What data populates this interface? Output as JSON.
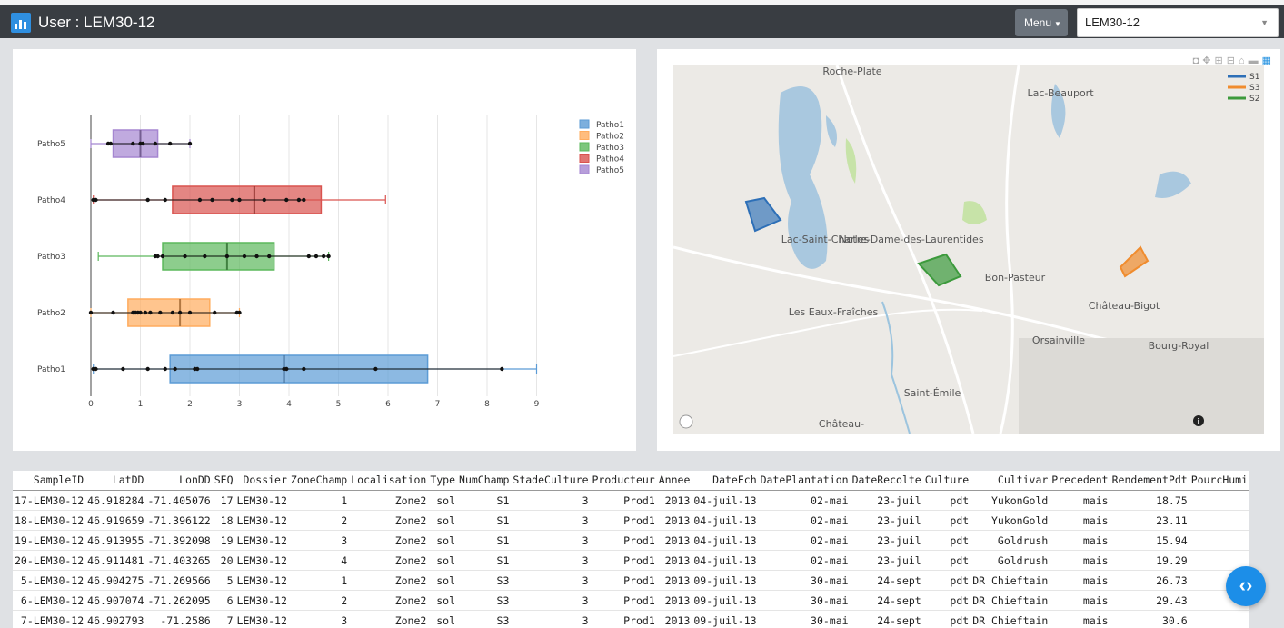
{
  "header": {
    "title": "User : LEM30-12",
    "menu_label": "Menu",
    "user_select_value": "LEM30-12"
  },
  "chart_data": {
    "type": "box",
    "orientation": "horizontal",
    "x_range": [
      0,
      9.5
    ],
    "x_ticks": [
      0,
      1,
      2,
      3,
      4,
      5,
      6,
      7,
      8,
      9
    ],
    "grid": true,
    "legend_position": "top-right",
    "series": [
      {
        "name": "Patho1",
        "color": "#5b9bd5",
        "min": 0.05,
        "q1": 1.6,
        "median": 3.9,
        "q3": 6.8,
        "max": 9.0,
        "points": [
          0.05,
          0.1,
          0.65,
          1.15,
          1.5,
          1.7,
          2.1,
          2.15,
          3.9,
          3.95,
          4.3,
          5.75,
          8.3
        ]
      },
      {
        "name": "Patho2",
        "color": "#ffac5e",
        "min": 0.0,
        "q1": 0.75,
        "median": 1.8,
        "q3": 2.4,
        "max": 3.0,
        "points": [
          0.0,
          0.45,
          0.85,
          0.9,
          0.95,
          1.0,
          1.1,
          1.2,
          1.4,
          1.65,
          1.8,
          2.0,
          2.5,
          2.95,
          3.0
        ]
      },
      {
        "name": "Patho3",
        "color": "#5cb85c",
        "min": 0.15,
        "q1": 1.45,
        "median": 2.75,
        "q3": 3.7,
        "max": 4.8,
        "points": [
          1.3,
          1.35,
          1.45,
          1.9,
          2.3,
          2.75,
          3.1,
          3.35,
          3.6,
          4.4,
          4.55,
          4.7,
          4.8
        ]
      },
      {
        "name": "Patho4",
        "color": "#d9534f",
        "min": 0.05,
        "q1": 1.65,
        "median": 3.3,
        "q3": 4.65,
        "max": 5.95,
        "points": [
          0.05,
          0.1,
          1.15,
          1.5,
          2.2,
          2.45,
          2.85,
          3.0,
          3.5,
          3.95,
          4.2,
          4.3
        ]
      },
      {
        "name": "Patho5",
        "color": "#a586d1",
        "min": 0.0,
        "q1": 0.45,
        "median": 1.0,
        "q3": 1.35,
        "max": 2.0,
        "points": [
          0.35,
          0.4,
          0.85,
          1.0,
          1.05,
          1.3,
          1.6,
          2.0
        ]
      }
    ]
  },
  "map": {
    "places": [
      "Roche-Plate",
      "Lac-Beauport",
      "Lac-Saint-Charles",
      "Notre-Dame-des-Laurentides",
      "Bon-Pasteur",
      "Château-Bigot",
      "Les Eaux-Fraîches",
      "Orsainville",
      "Bourg-Royal",
      "Saint-Émile",
      "Château-"
    ],
    "legend": [
      {
        "name": "S1",
        "color": "#2d6fb7"
      },
      {
        "name": "S3",
        "color": "#f08c2e"
      },
      {
        "name": "S2",
        "color": "#3c9a3c"
      }
    ],
    "polygons": [
      {
        "name": "S1",
        "color": "#2d6fb7"
      },
      {
        "name": "S2",
        "color": "#3c9a3c"
      },
      {
        "name": "S3",
        "color": "#f08c2e"
      }
    ],
    "toolbar_icons": [
      "camera-icon",
      "pan-icon",
      "zoom-in-icon",
      "zoom-out-icon",
      "home-icon",
      "select-icon",
      "plotly-logo-icon"
    ]
  },
  "table": {
    "columns": [
      "SampleID",
      "LatDD",
      "LonDD",
      "SEQ",
      "Dossier",
      "ZoneChamp",
      "Localisation",
      "Type",
      "NumChamp",
      "StadeCulture",
      "Producteur",
      "Annee",
      "DateEch",
      "DatePlantation",
      "DateRecolte",
      "Culture",
      "Cultivar",
      "Precedent",
      "RendementPdt",
      "PourcHumi"
    ],
    "rows": [
      [
        "17-LEM30-12",
        "46.918284",
        "-71.405076",
        "17",
        "LEM30-12",
        "1",
        "Zone2",
        "sol",
        "S1",
        "3",
        "Prod1",
        "2013",
        "04-juil-13",
        "02-mai",
        "23-juil",
        "pdt",
        "YukonGold",
        "mais",
        "18.75",
        ""
      ],
      [
        "18-LEM30-12",
        "46.919659",
        "-71.396122",
        "18",
        "LEM30-12",
        "2",
        "Zone2",
        "sol",
        "S1",
        "3",
        "Prod1",
        "2013",
        "04-juil-13",
        "02-mai",
        "23-juil",
        "pdt",
        "YukonGold",
        "mais",
        "23.11",
        ""
      ],
      [
        "19-LEM30-12",
        "46.913955",
        "-71.392098",
        "19",
        "LEM30-12",
        "3",
        "Zone2",
        "sol",
        "S1",
        "3",
        "Prod1",
        "2013",
        "04-juil-13",
        "02-mai",
        "23-juil",
        "pdt",
        "Goldrush",
        "mais",
        "15.94",
        ""
      ],
      [
        "20-LEM30-12",
        "46.911481",
        "-71.403265",
        "20",
        "LEM30-12",
        "4",
        "Zone2",
        "sol",
        "S1",
        "3",
        "Prod1",
        "2013",
        "04-juil-13",
        "02-mai",
        "23-juil",
        "pdt",
        "Goldrush",
        "mais",
        "19.29",
        ""
      ],
      [
        "5-LEM30-12",
        "46.904275",
        "-71.269566",
        "5",
        "LEM30-12",
        "1",
        "Zone2",
        "sol",
        "S3",
        "3",
        "Prod1",
        "2013",
        "09-juil-13",
        "30-mai",
        "24-sept",
        "pdt",
        "DR Chieftain",
        "mais",
        "26.73",
        ""
      ],
      [
        "6-LEM30-12",
        "46.907074",
        "-71.262095",
        "6",
        "LEM30-12",
        "2",
        "Zone2",
        "sol",
        "S3",
        "3",
        "Prod1",
        "2013",
        "09-juil-13",
        "30-mai",
        "24-sept",
        "pdt",
        "DR Chieftain",
        "mais",
        "29.43",
        ""
      ],
      [
        "7-LEM30-12",
        "46.902793",
        "-71.2586",
        "7",
        "LEM30-12",
        "3",
        "Zone2",
        "sol",
        "S3",
        "3",
        "Prod1",
        "2013",
        "09-juil-13",
        "30-mai",
        "24-sept",
        "pdt",
        "DR Chieftain",
        "mais",
        "30.6",
        ""
      ]
    ]
  }
}
